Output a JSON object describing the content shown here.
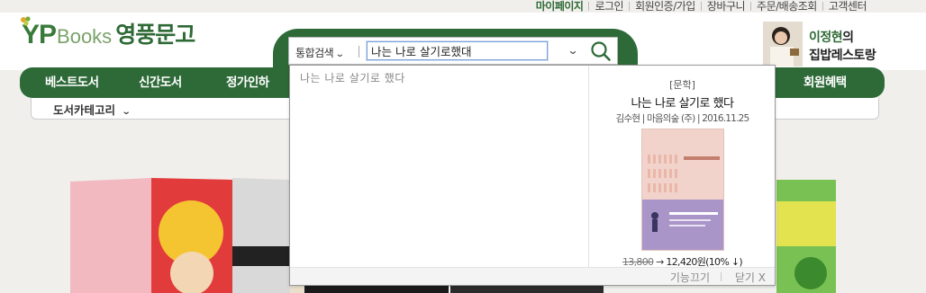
{
  "util_links": [
    "마이페이지",
    "로그인",
    "회원인증/가입",
    "장바구니",
    "주문/배송조회",
    "고객센터"
  ],
  "logo": {
    "en": "YP",
    "books": "Books",
    "kor": "영풍문고"
  },
  "nav": {
    "items": [
      "베스트도서",
      "신간도서",
      "정가인하",
      "회원혜택"
    ],
    "category_label": "도서카테고리"
  },
  "search": {
    "scope_label": "통합검색",
    "query": "나는 나로 살기로했대"
  },
  "autocomplete": {
    "suggestion": "나는 나로 살기로 했다",
    "preview": {
      "category": "[문학]",
      "title": "나는 나로 살기로 했다",
      "meta": "김수현 | 마음의숲 (주) | 2016.11.25",
      "original_price": "13,800",
      "arrow": "→",
      "sale_price": "12,420원(10% ↓)"
    },
    "feature_off_label": "기능끄기",
    "close_label": "닫기 X"
  },
  "banner": {
    "name": "이정현",
    "suffix": "의",
    "line2": "집밥레스토랑"
  },
  "colors": {
    "brand_green": "#2e6a38",
    "nav_text": "#ffffff",
    "search_focus": "#7aa0d8"
  }
}
